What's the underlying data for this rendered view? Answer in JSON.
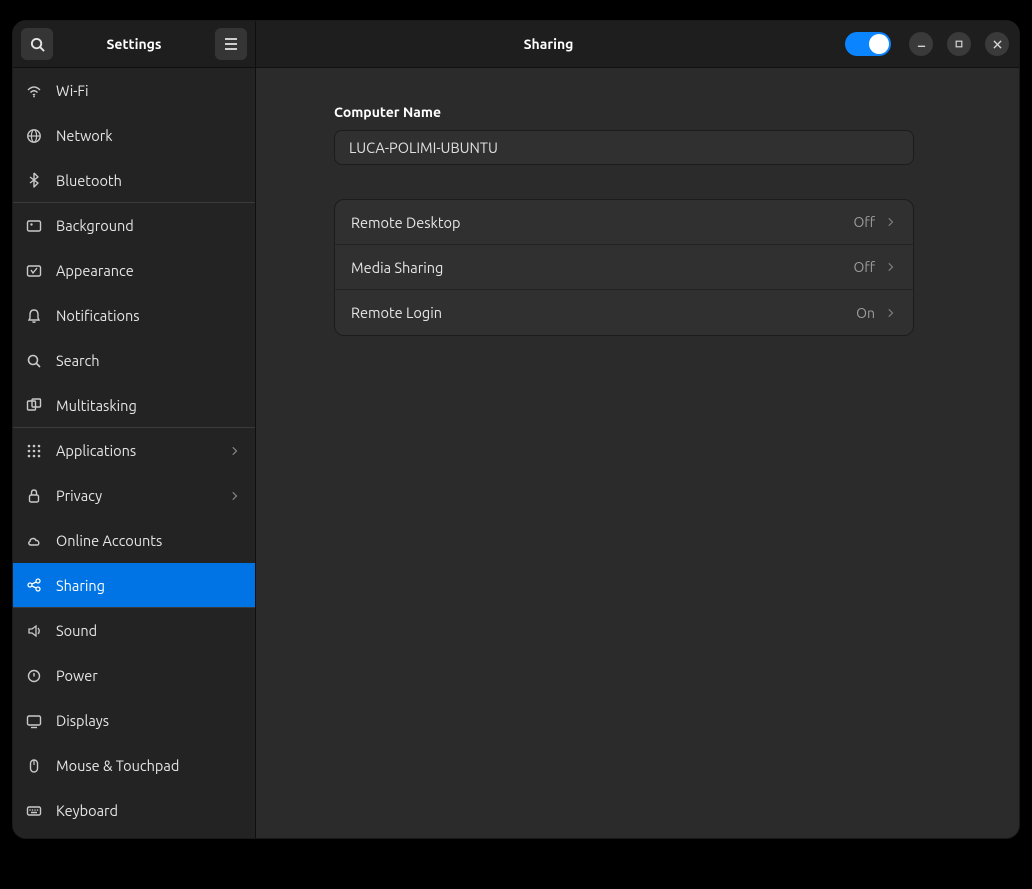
{
  "sidebar": {
    "title": "Settings",
    "items": [
      {
        "label": "Wi-Fi",
        "name": "sidebar-item-wifi",
        "icon": "wifi-icon"
      },
      {
        "label": "Network",
        "name": "sidebar-item-network",
        "icon": "network-icon"
      },
      {
        "label": "Bluetooth",
        "name": "sidebar-item-bluetooth",
        "icon": "bluetooth-icon"
      },
      {
        "label": "Background",
        "name": "sidebar-item-background",
        "icon": "background-icon"
      },
      {
        "label": "Appearance",
        "name": "sidebar-item-appearance",
        "icon": "appearance-icon"
      },
      {
        "label": "Notifications",
        "name": "sidebar-item-notifications",
        "icon": "bell-icon"
      },
      {
        "label": "Search",
        "name": "sidebar-item-search",
        "icon": "search-icon"
      },
      {
        "label": "Multitasking",
        "name": "sidebar-item-multitasking",
        "icon": "multitasking-icon"
      },
      {
        "label": "Applications",
        "name": "sidebar-item-applications",
        "icon": "apps-icon"
      },
      {
        "label": "Privacy",
        "name": "sidebar-item-privacy",
        "icon": "lock-icon"
      },
      {
        "label": "Online Accounts",
        "name": "sidebar-item-online-accounts",
        "icon": "cloud-icon"
      },
      {
        "label": "Sharing",
        "name": "sidebar-item-sharing",
        "icon": "share-icon"
      },
      {
        "label": "Sound",
        "name": "sidebar-item-sound",
        "icon": "sound-icon"
      },
      {
        "label": "Power",
        "name": "sidebar-item-power",
        "icon": "power-icon"
      },
      {
        "label": "Displays",
        "name": "sidebar-item-displays",
        "icon": "display-icon"
      },
      {
        "label": "Mouse & Touchpad",
        "name": "sidebar-item-mouse-touchpad",
        "icon": "mouse-icon"
      },
      {
        "label": "Keyboard",
        "name": "sidebar-item-keyboard",
        "icon": "keyboard-icon"
      }
    ],
    "selected_index": 11,
    "group_end_indices": [
      2,
      7,
      11
    ],
    "chevron_indices": [
      8,
      9
    ]
  },
  "header": {
    "title": "Sharing",
    "toggle_on": true
  },
  "main": {
    "computer_name_label": "Computer Name",
    "computer_name_value": "LUCA-POLIMI-UBUNTU",
    "rows": [
      {
        "label": "Remote Desktop",
        "status": "Off",
        "name": "row-remote-desktop"
      },
      {
        "label": "Media Sharing",
        "status": "Off",
        "name": "row-media-sharing"
      },
      {
        "label": "Remote Login",
        "status": "On",
        "name": "row-remote-login"
      }
    ]
  },
  "colors": {
    "accent": "#0073e5",
    "toggle": "#0a84ff"
  }
}
